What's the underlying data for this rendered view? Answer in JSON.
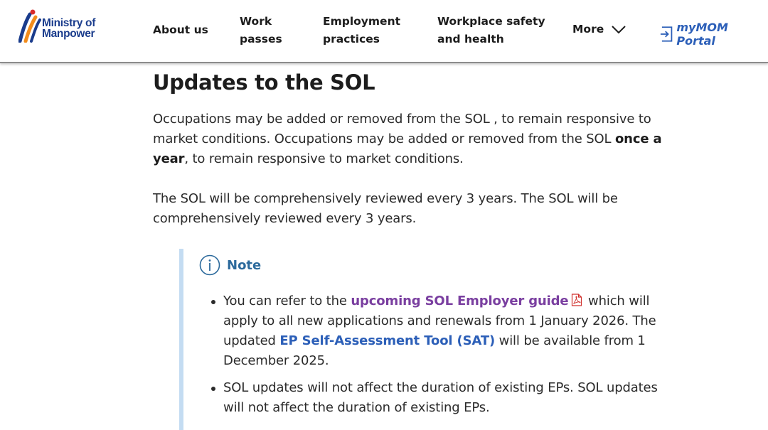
{
  "header": {
    "logo": {
      "line1": "Ministry of",
      "line2": "Manpower"
    },
    "nav": {
      "about": "About us",
      "work_line1": "Work",
      "work_line2": "passes",
      "emp_line1": "Employment",
      "emp_line2": "practices",
      "wsh_line1": "Workplace safety",
      "wsh_line2": "and health",
      "more": "More"
    },
    "portal": "myMOM Portal"
  },
  "section": {
    "title": "Updates to the SOL",
    "para1_a": "Occupations may be added or removed from the SOL , to remain responsive to market conditions. Occupations may be added or removed from the SOL ",
    "para1_bold": "once a year",
    "para1_b": ", to remain responsive to market conditions.",
    "para2": "The SOL will be comprehensively reviewed every 3 years. The SOL will be comprehensively reviewed every 3 years."
  },
  "note": {
    "title": "Note",
    "item1_a": "You can refer to the ",
    "item1_link": "upcoming SOL Employer guide",
    "item1_b": " which will apply to all new applications and renewals from 1 January 2026. The updated ",
    "item1_link2": "EP Self-Assessment Tool (SAT)",
    "item1_c": " will be available from 1 December 2025.",
    "item2": "SOL updates will not affect the duration of existing EPs. SOL updates will not affect the duration of existing EPs."
  },
  "colors": {
    "brand_blue": "#1a3c8c",
    "link_blue": "#2c5fb8",
    "link_purple": "#7a3fa0",
    "note_border": "#c4dcf2",
    "pdf_red": "#d0312d"
  },
  "icons": [
    "mom-logo-icon",
    "chevron-down-icon",
    "portal-login-icon",
    "info-icon",
    "pdf-icon"
  ]
}
